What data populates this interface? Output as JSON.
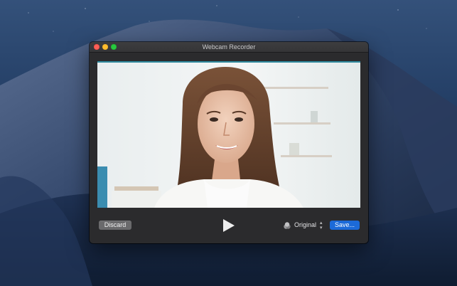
{
  "window": {
    "title": "Webcam Recorder"
  },
  "controls": {
    "discard_label": "Discard",
    "format_label": "Original",
    "save_label": "Save..."
  },
  "icons": {
    "close": "close-icon",
    "minimize": "minimize-icon",
    "zoom": "zoom-icon",
    "play": "play-icon",
    "format": "filter-icon",
    "chevron": "chevron-updown-icon"
  },
  "colors": {
    "save_accent": "#1c6ad8",
    "window_bg": "#2b2b2d",
    "close": "#fe5f57",
    "minimize": "#febc2e",
    "zoom": "#28c840"
  }
}
